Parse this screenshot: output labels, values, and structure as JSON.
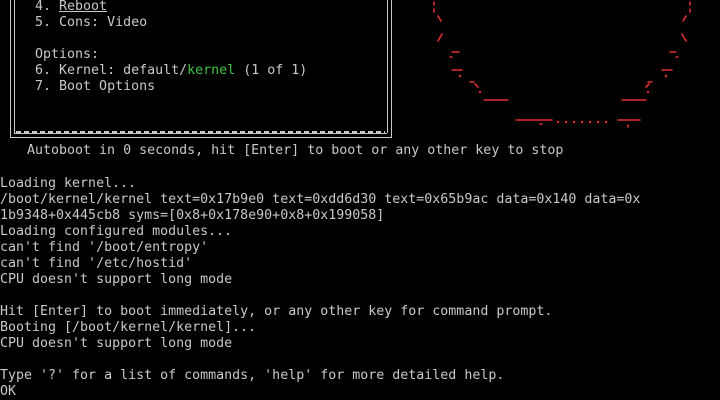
{
  "menu": {
    "items": [
      {
        "number": "4.",
        "label": "Reboot"
      },
      {
        "number": "5.",
        "label": "Cons: Video"
      }
    ],
    "options_header": "Options:",
    "option_items": [
      {
        "number": "6.",
        "label_prefix": "Kernel: default/",
        "kernel_name": "kernel",
        "count": "(1 of 1)"
      },
      {
        "number": "7.",
        "label": "Boot Options"
      }
    ]
  },
  "autoboot": "Autoboot in 0 seconds, hit [Enter] to boot or any other key to stop",
  "console_lines": [
    "Loading kernel...",
    "/boot/kernel/kernel text=0x17b9e0 text=0xdd6d30 text=0x65b9ac data=0x140 data=0x",
    "1b9348+0x445cb8 syms=[0x8+0x178e90+0x8+0x199058]",
    "Loading configured modules...",
    "can't find '/boot/entropy'",
    "can't find '/etc/hostid'",
    "CPU doesn't support long mode",
    "",
    "Hit [Enter] to boot immediately, or any other key for command prompt.",
    "Booting [/boot/kernel/kernel]...",
    "CPU doesn't support long mode",
    "",
    "Type '?' for a list of commands, 'help' for more detailed help.",
    "OK"
  ],
  "colors": {
    "text": "#c8c8c8",
    "kernel_highlight": "#3fc23f",
    "logo": "#e03030",
    "background": "#000000"
  }
}
